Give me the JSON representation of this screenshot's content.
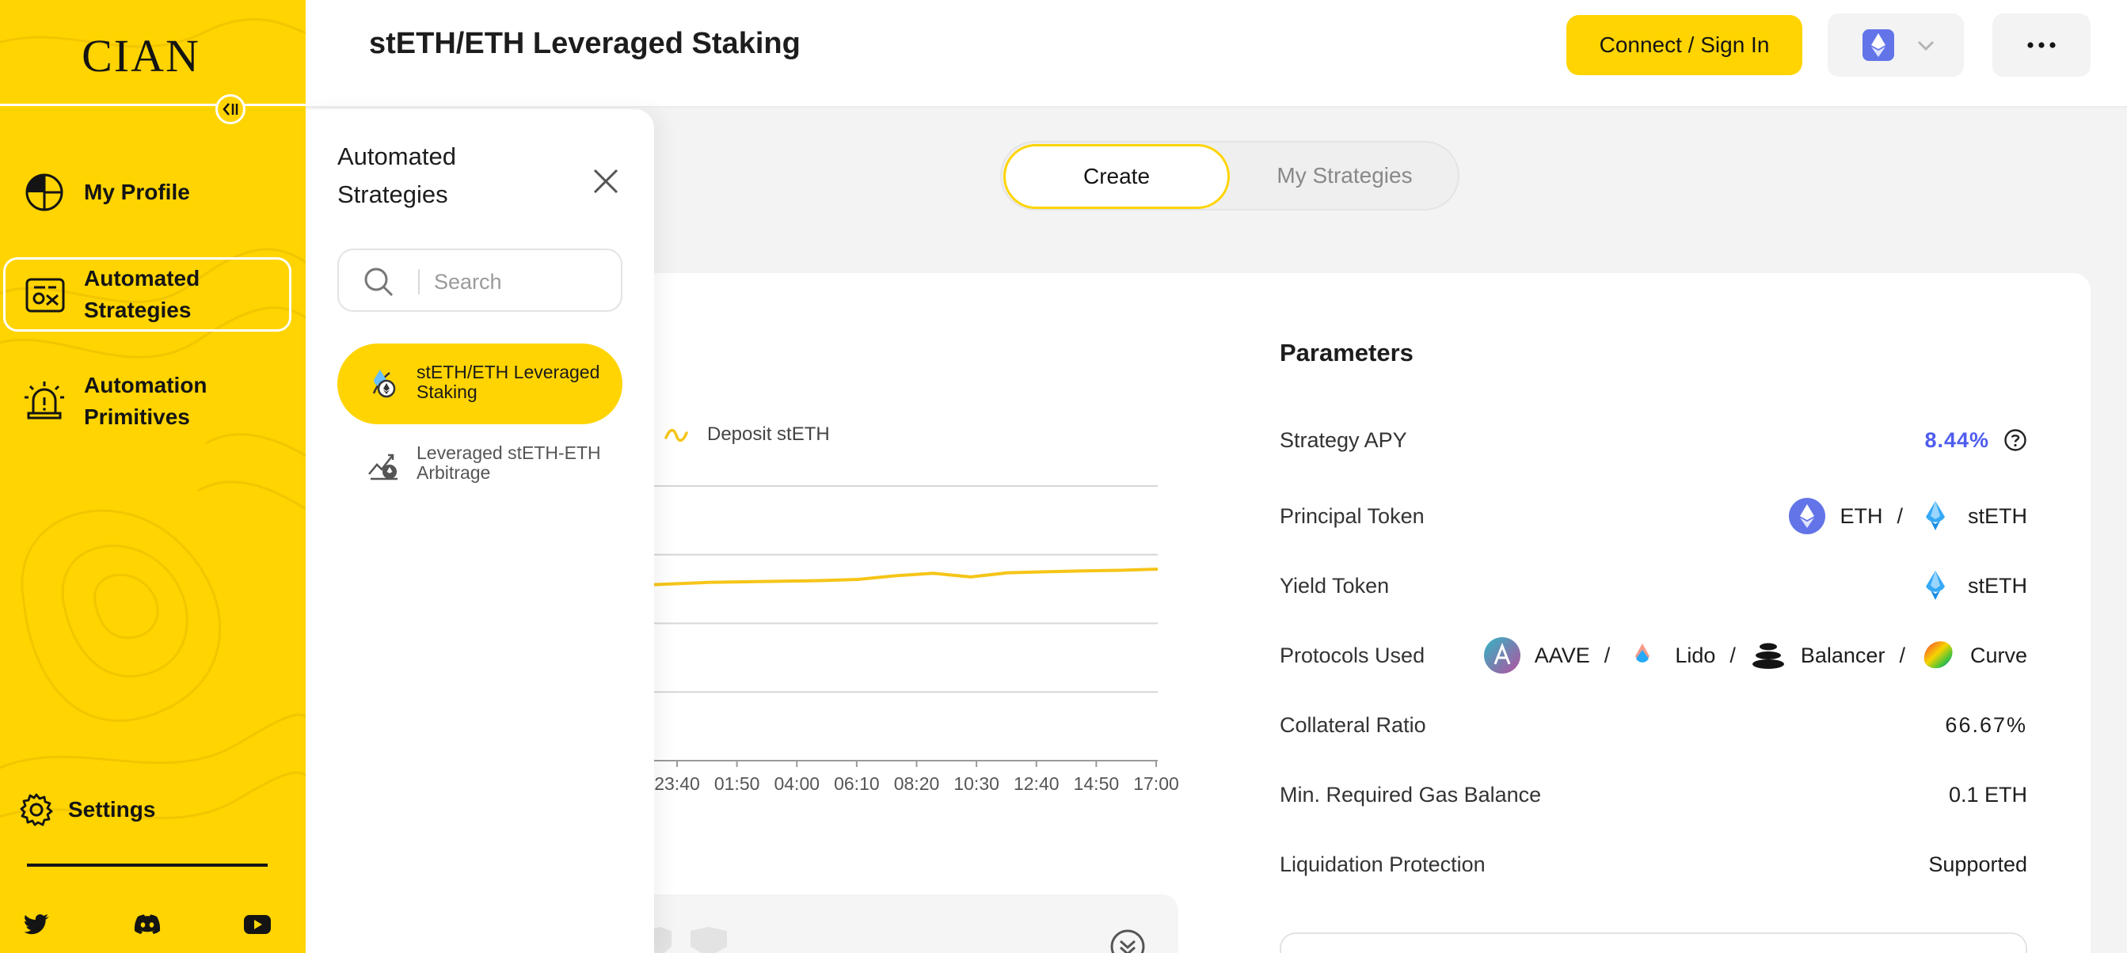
{
  "brand": {
    "logo_text": "CIAN",
    "accent": "#FFD400"
  },
  "sidebar": {
    "items": [
      {
        "label": "My Profile",
        "icon": "pie-chart-icon"
      },
      {
        "label": "Automated Strategies",
        "icon": "strategy-icon",
        "active": true
      },
      {
        "label": "Automation Primitives",
        "icon": "alarm-icon"
      }
    ],
    "settings_label": "Settings",
    "social": [
      "twitter-icon",
      "discord-icon",
      "youtube-icon"
    ]
  },
  "header": {
    "title": "stETH/ETH Leveraged Staking",
    "connect_label": "Connect / Sign In",
    "network_icon": "ethereum-icon"
  },
  "tabs": {
    "create": "Create",
    "my_strategies": "My Strategies",
    "selected": "Create"
  },
  "panel": {
    "title": "Automated Strategies",
    "search_placeholder": "Search",
    "strategies": [
      {
        "label": "stETH/ETH Leveraged Staking",
        "active": true
      },
      {
        "label": "Leveraged stETH-ETH Arbitrage",
        "active": false
      }
    ]
  },
  "chart_data": {
    "type": "line",
    "series": [
      {
        "name": "Deposit stETH",
        "color": "#F5C518",
        "values": [
          0.58,
          0.585,
          0.59,
          0.592,
          0.594,
          0.596,
          0.6,
          0.612,
          0.62,
          0.608,
          0.622,
          0.625,
          0.628,
          0.63,
          0.634
        ]
      }
    ],
    "categories": [
      "23:40",
      "01:50",
      "04:00",
      "06:10",
      "08:20",
      "10:30",
      "12:40",
      "14:50",
      "17:00"
    ],
    "grid": true
  },
  "parameters": {
    "title": "Parameters",
    "rows": {
      "apy": {
        "label": "Strategy APY",
        "value": "8.44%"
      },
      "principal": {
        "label": "Principal Token",
        "tokens": [
          "ETH",
          "stETH"
        ],
        "sep": "/"
      },
      "yield": {
        "label": "Yield Token",
        "token": "stETH"
      },
      "protocols": {
        "label": "Protocols Used",
        "items": [
          "AAVE",
          "Lido",
          "Balancer",
          "Curve"
        ],
        "sep": "/"
      },
      "collateral": {
        "label": "Collateral Ratio",
        "value": "66.67%"
      },
      "gas": {
        "label": "Min. Required Gas Balance",
        "value": "0.1 ETH"
      },
      "liquidation": {
        "label": "Liquidation Protection",
        "value": "Supported"
      }
    }
  }
}
